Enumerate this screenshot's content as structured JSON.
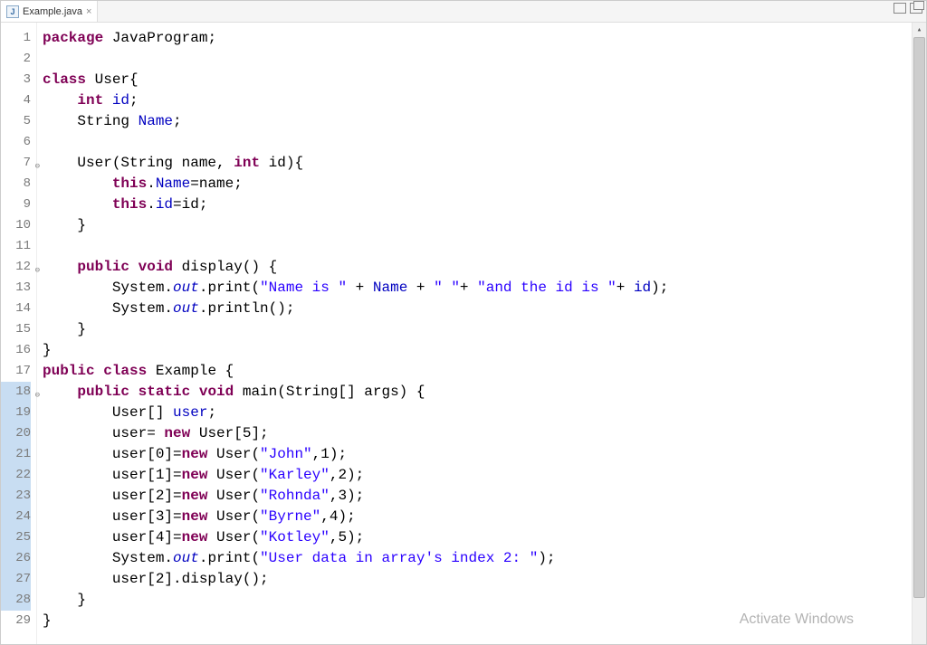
{
  "tab": {
    "filename": "Example.java",
    "close": "×"
  },
  "watermark": "Activate Windows",
  "code": {
    "lines": [
      {
        "n": "1",
        "fold": "",
        "hl": false,
        "tokens": [
          [
            "kw",
            "package"
          ],
          [
            "nm",
            " JavaProgram;"
          ]
        ]
      },
      {
        "n": "2",
        "fold": "",
        "hl": false,
        "tokens": []
      },
      {
        "n": "3",
        "fold": "",
        "hl": false,
        "tokens": [
          [
            "kw",
            "class"
          ],
          [
            "nm",
            " User{"
          ]
        ]
      },
      {
        "n": "4",
        "fold": "",
        "hl": false,
        "tokens": [
          [
            "nm",
            "    "
          ],
          [
            "kw",
            "int"
          ],
          [
            "nm",
            " "
          ],
          [
            "fld",
            "id"
          ],
          [
            "nm",
            ";"
          ]
        ]
      },
      {
        "n": "5",
        "fold": "",
        "hl": false,
        "tokens": [
          [
            "nm",
            "    String "
          ],
          [
            "fld",
            "Name"
          ],
          [
            "nm",
            ";"
          ]
        ]
      },
      {
        "n": "6",
        "fold": "",
        "hl": false,
        "tokens": []
      },
      {
        "n": "7",
        "fold": "⊖",
        "hl": false,
        "tokens": [
          [
            "nm",
            "    User(String name, "
          ],
          [
            "kw",
            "int"
          ],
          [
            "nm",
            " id){"
          ]
        ]
      },
      {
        "n": "8",
        "fold": "",
        "hl": false,
        "tokens": [
          [
            "nm",
            "        "
          ],
          [
            "kw",
            "this"
          ],
          [
            "nm",
            "."
          ],
          [
            "fld",
            "Name"
          ],
          [
            "nm",
            "=name;"
          ]
        ]
      },
      {
        "n": "9",
        "fold": "",
        "hl": false,
        "tokens": [
          [
            "nm",
            "        "
          ],
          [
            "kw",
            "this"
          ],
          [
            "nm",
            "."
          ],
          [
            "fld",
            "id"
          ],
          [
            "nm",
            "=id;"
          ]
        ]
      },
      {
        "n": "10",
        "fold": "",
        "hl": false,
        "tokens": [
          [
            "nm",
            "    }"
          ]
        ]
      },
      {
        "n": "11",
        "fold": "",
        "hl": false,
        "tokens": []
      },
      {
        "n": "12",
        "fold": "⊖",
        "hl": false,
        "tokens": [
          [
            "nm",
            "    "
          ],
          [
            "kw",
            "public"
          ],
          [
            "nm",
            " "
          ],
          [
            "kw",
            "void"
          ],
          [
            "nm",
            " display() {"
          ]
        ]
      },
      {
        "n": "13",
        "fold": "",
        "hl": false,
        "tokens": [
          [
            "nm",
            "        System."
          ],
          [
            "itc",
            "out"
          ],
          [
            "nm",
            ".print("
          ],
          [
            "str",
            "\"Name is \""
          ],
          [
            "nm",
            " + "
          ],
          [
            "fld",
            "Name"
          ],
          [
            "nm",
            " + "
          ],
          [
            "str",
            "\" \""
          ],
          [
            "nm",
            "+ "
          ],
          [
            "str",
            "\"and the id is \""
          ],
          [
            "nm",
            "+ "
          ],
          [
            "fld",
            "id"
          ],
          [
            "nm",
            ");"
          ]
        ]
      },
      {
        "n": "14",
        "fold": "",
        "hl": false,
        "tokens": [
          [
            "nm",
            "        System."
          ],
          [
            "itc",
            "out"
          ],
          [
            "nm",
            ".println();"
          ]
        ]
      },
      {
        "n": "15",
        "fold": "",
        "hl": false,
        "tokens": [
          [
            "nm",
            "    }"
          ]
        ]
      },
      {
        "n": "16",
        "fold": "",
        "hl": false,
        "tokens": [
          [
            "nm",
            "}"
          ]
        ]
      },
      {
        "n": "17",
        "fold": "",
        "hl": false,
        "tokens": [
          [
            "kw",
            "public"
          ],
          [
            "nm",
            " "
          ],
          [
            "kw",
            "class"
          ],
          [
            "nm",
            " Example {"
          ]
        ]
      },
      {
        "n": "18",
        "fold": "⊖",
        "hl": true,
        "tokens": [
          [
            "nm",
            "    "
          ],
          [
            "kw",
            "public"
          ],
          [
            "nm",
            " "
          ],
          [
            "kw",
            "static"
          ],
          [
            "nm",
            " "
          ],
          [
            "kw",
            "void"
          ],
          [
            "nm",
            " main(String[] args) {"
          ]
        ]
      },
      {
        "n": "19",
        "fold": "",
        "hl": true,
        "tokens": [
          [
            "nm",
            "        User[] "
          ],
          [
            "fld",
            "user"
          ],
          [
            "nm",
            ";"
          ]
        ]
      },
      {
        "n": "20",
        "fold": "",
        "hl": true,
        "tokens": [
          [
            "nm",
            "        user= "
          ],
          [
            "kw",
            "new"
          ],
          [
            "nm",
            " User[5];"
          ]
        ]
      },
      {
        "n": "21",
        "fold": "",
        "hl": true,
        "tokens": [
          [
            "nm",
            "        user[0]="
          ],
          [
            "kw",
            "new"
          ],
          [
            "nm",
            " User("
          ],
          [
            "str",
            "\"John\""
          ],
          [
            "nm",
            ",1);"
          ]
        ]
      },
      {
        "n": "22",
        "fold": "",
        "hl": true,
        "tokens": [
          [
            "nm",
            "        user[1]="
          ],
          [
            "kw",
            "new"
          ],
          [
            "nm",
            " User("
          ],
          [
            "str",
            "\"Karley\""
          ],
          [
            "nm",
            ",2);"
          ]
        ]
      },
      {
        "n": "23",
        "fold": "",
        "hl": true,
        "tokens": [
          [
            "nm",
            "        user[2]="
          ],
          [
            "kw",
            "new"
          ],
          [
            "nm",
            " User("
          ],
          [
            "str",
            "\"Rohnda\""
          ],
          [
            "nm",
            ",3);"
          ]
        ]
      },
      {
        "n": "24",
        "fold": "",
        "hl": true,
        "tokens": [
          [
            "nm",
            "        user[3]="
          ],
          [
            "kw",
            "new"
          ],
          [
            "nm",
            " User("
          ],
          [
            "str",
            "\"Byrne\""
          ],
          [
            "nm",
            ",4);"
          ]
        ]
      },
      {
        "n": "25",
        "fold": "",
        "hl": true,
        "tokens": [
          [
            "nm",
            "        user[4]="
          ],
          [
            "kw",
            "new"
          ],
          [
            "nm",
            " User("
          ],
          [
            "str",
            "\"Kotley\""
          ],
          [
            "nm",
            ",5);"
          ]
        ]
      },
      {
        "n": "26",
        "fold": "",
        "hl": true,
        "tokens": [
          [
            "nm",
            "        System."
          ],
          [
            "itc",
            "out"
          ],
          [
            "nm",
            ".print("
          ],
          [
            "str",
            "\"User data in array's index 2: \""
          ],
          [
            "nm",
            ");"
          ]
        ]
      },
      {
        "n": "27",
        "fold": "",
        "hl": true,
        "tokens": [
          [
            "nm",
            "        user[2].display();"
          ]
        ]
      },
      {
        "n": "28",
        "fold": "",
        "hl": true,
        "tokens": [
          [
            "nm",
            "    }"
          ]
        ]
      },
      {
        "n": "29",
        "fold": "",
        "hl": false,
        "tokens": [
          [
            "nm",
            "}"
          ]
        ]
      }
    ]
  }
}
